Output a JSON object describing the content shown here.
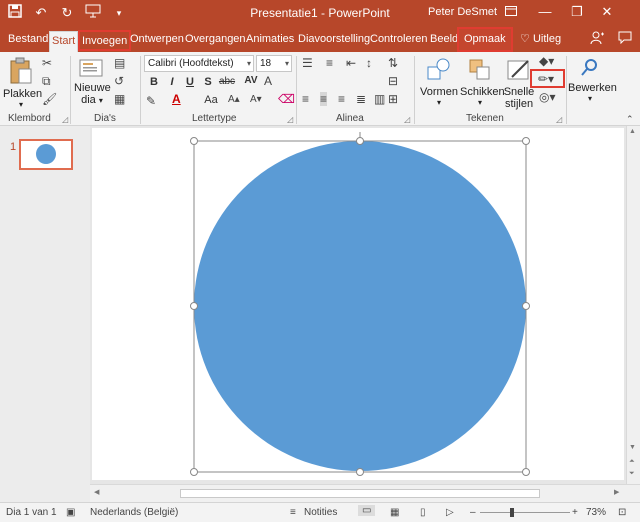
{
  "titlebar": {
    "title": "Presentatie1 - PowerPoint",
    "user": "Peter DeSmet",
    "qat_icons": [
      "save-icon",
      "undo-icon",
      "redo-icon",
      "presenter-icon",
      "customize-icon"
    ],
    "window_icons": [
      "ribbon-display-icon",
      "minimize-icon",
      "restore-icon",
      "close-icon"
    ]
  },
  "tabs": {
    "bestand": "Bestand",
    "start": "Start",
    "invoegen": "Invoegen",
    "ontwerpen": "Ontwerpen",
    "overgangen": "Overgangen",
    "animaties": "Animaties",
    "diavoorstelling": "Diavoorstelling",
    "controleren": "Controleren",
    "beeld": "Beeld",
    "opmaak": "Opmaak",
    "uitleg": "Uitleg"
  },
  "ribbon": {
    "klembord": {
      "label": "Klembord",
      "plakken": "Plakken"
    },
    "dias": {
      "label": "Dia's",
      "nieuwe_dia_line1": "Nieuwe",
      "nieuwe_dia_line2": "dia"
    },
    "lettertype": {
      "label": "Lettertype",
      "font_name": "Calibri (Hoofdtekst)",
      "font_size": "18",
      "bold": "B",
      "italic": "I",
      "underline": "U",
      "shadow": "S",
      "strike": "abc",
      "spacing": "AV",
      "case": "Aa"
    },
    "alinea": {
      "label": "Alinea"
    },
    "tekenen": {
      "label": "Tekenen",
      "vormen": "Vormen",
      "schikken": "Schikken",
      "snelle_line1": "Snelle",
      "snelle_line2": "stijlen"
    },
    "bewerken": {
      "label": "Bewerken"
    }
  },
  "thumbnails": {
    "slide_number": "1"
  },
  "status": {
    "slide_info": "Dia 1 van 1",
    "language": "Nederlands (België)",
    "notes": "Notities",
    "zoom": "73%"
  },
  "colors": {
    "accent": "#b7472a",
    "shape_fill": "#5b9bd5",
    "highlight_box": "#e03c31"
  }
}
